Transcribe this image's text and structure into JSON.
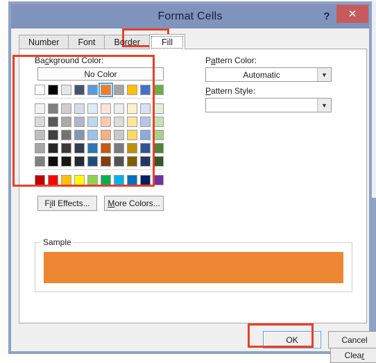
{
  "window": {
    "title": "Format Cells",
    "help_icon": "question-mark-icon",
    "close_icon": "✕",
    "titlebar_color": "#8093bc",
    "close_button_color": "#c75b5b",
    "frame_color": "#8fa1c4"
  },
  "tabs": [
    {
      "label": "Number",
      "selected": false
    },
    {
      "label": "Font",
      "selected": false
    },
    {
      "label": "Border",
      "selected": false
    },
    {
      "label": "Fill",
      "selected": true
    }
  ],
  "fill_tab": {
    "background_color": {
      "label_pre": "Ba",
      "label_accel": "c",
      "label_post": "kground Color:",
      "full_label": "Background Color:",
      "no_color_label": "No Color",
      "theme_colors": [
        "#ffffff",
        "#000000",
        "#e7e6e6",
        "#44546a",
        "#5b9bd5",
        "#ed7d31",
        "#a5a5a5",
        "#ffc000",
        "#4472c4",
        "#70ad47"
      ],
      "theme_variants": [
        [
          "#f2f2f2",
          "#808080",
          "#d0cece",
          "#d6dce5",
          "#deebf7",
          "#fbe5d6",
          "#ededed",
          "#fff2cc",
          "#d9e2f3",
          "#e2efd9"
        ],
        [
          "#d9d9d9",
          "#595959",
          "#aeaaaa",
          "#adb9ca",
          "#bdd7ee",
          "#f8cbad",
          "#dbdbdb",
          "#ffe699",
          "#b4c6e7",
          "#c5e0b3"
        ],
        [
          "#bfbfbf",
          "#404040",
          "#757171",
          "#8496b0",
          "#9dc3e6",
          "#f4b183",
          "#c9c9c9",
          "#ffd966",
          "#8eaadb",
          "#a8d08d"
        ],
        [
          "#a6a6a6",
          "#262626",
          "#3b3838",
          "#333f4f",
          "#2e75b5",
          "#c55a11",
          "#7b7b7b",
          "#bf8f00",
          "#2f5496",
          "#538135"
        ],
        [
          "#808080",
          "#0d0d0d",
          "#171616",
          "#222b35",
          "#1f4e79",
          "#833c0b",
          "#525252",
          "#7f6000",
          "#1f3763",
          "#375623"
        ]
      ],
      "standard_colors": [
        "#c00000",
        "#ff0000",
        "#ffc000",
        "#ffff00",
        "#92d050",
        "#00b050",
        "#00b0f0",
        "#0070c0",
        "#002060",
        "#7030a0"
      ],
      "selected_color": "#ed7d31",
      "selected_index": 5,
      "selection_border_color": "#5a9fd4"
    },
    "fill_effects_button": {
      "pre": "F",
      "accel": "i",
      "post": "ll Effects...",
      "full_label": "Fill Effects..."
    },
    "more_colors_button": {
      "pre": "",
      "accel": "M",
      "post": "ore Colors...",
      "full_label": "More Colors..."
    },
    "pattern_color": {
      "label_pre": "P",
      "label_accel": "a",
      "label_post": "ttern Color:",
      "full_label": "Pattern Color:",
      "value": "Automatic",
      "arrow_icon": "chevron-down-icon"
    },
    "pattern_style": {
      "label_pre": "",
      "label_accel": "P",
      "label_post": "attern Style:",
      "full_label": "Pattern Style:",
      "value": "",
      "arrow_icon": "chevron-down-icon"
    },
    "sample": {
      "legend": "Sample",
      "fill_color": "#ed8733"
    },
    "clear_button": {
      "pre": "Clea",
      "accel": "r",
      "post": "",
      "full_label": "Clear"
    }
  },
  "footer": {
    "ok_label": "OK",
    "cancel_label": "Cancel"
  },
  "annotations": {
    "highlight_color": "#e8402a",
    "targets": [
      "fill-tab",
      "background-color-palette",
      "ok-button"
    ]
  }
}
